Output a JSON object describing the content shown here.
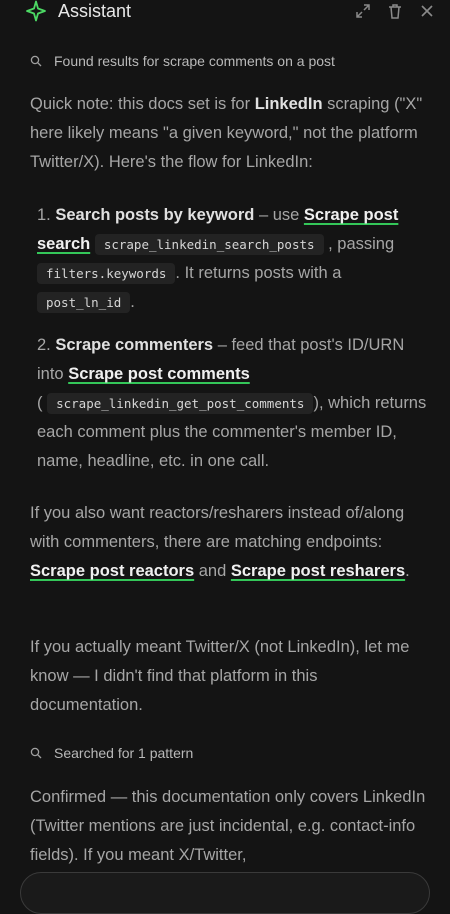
{
  "header": {
    "title": "Assistant",
    "icons": [
      "sparkle-icon",
      "expand-icon",
      "trash-icon",
      "close-icon"
    ]
  },
  "status1": {
    "text": "Found results for scrape comments on a post"
  },
  "intro": {
    "t1": "Quick note: this docs set is for ",
    "b1": "LinkedIn",
    "t2": " scraping (\"X\" here likely means \"a given keyword,\" not the platform Twitter/X). Here's the flow for LinkedIn:"
  },
  "steps": [
    {
      "num": "1.",
      "title": "Search posts by keyword",
      "t1": " – use ",
      "link": "Scrape post search",
      "code1": "scrape_linkedin_search_posts",
      "t2": " , passing ",
      "code2": "filters.keywords",
      "t3": ". It returns posts with a ",
      "code3": "post_ln_id",
      "t4": "."
    },
    {
      "num": "2.",
      "title": "Scrape commenters",
      "t1": " – feed that post's ID/URN into ",
      "link": "Scrape post comments",
      "code1": "scrape_linkedin_get_post_comments",
      "t2": "), which returns each comment plus the commenter's member ID, name, headline, etc. in one call."
    }
  ],
  "reactors": {
    "t1": "If you also want reactors/resharers instead of/along with commenters, there are matching endpoints: ",
    "link1": "Scrape post reactors",
    "t2": " and ",
    "link2": "Scrape post resharers",
    "t3": "."
  },
  "twitter": {
    "text": "If you actually meant Twitter/X (not LinkedIn), let me know — I didn't find that platform in this documentation."
  },
  "status2": {
    "text": "Searched for 1 pattern"
  },
  "confirm": {
    "text": "Confirmed — this documentation only covers LinkedIn (Twitter mentions are just incidental, e.g. contact-info fields). If you meant X/Twitter,"
  },
  "colors": {
    "background": "#141414",
    "link_underline": "#34c759",
    "code_bg": "#232323"
  }
}
